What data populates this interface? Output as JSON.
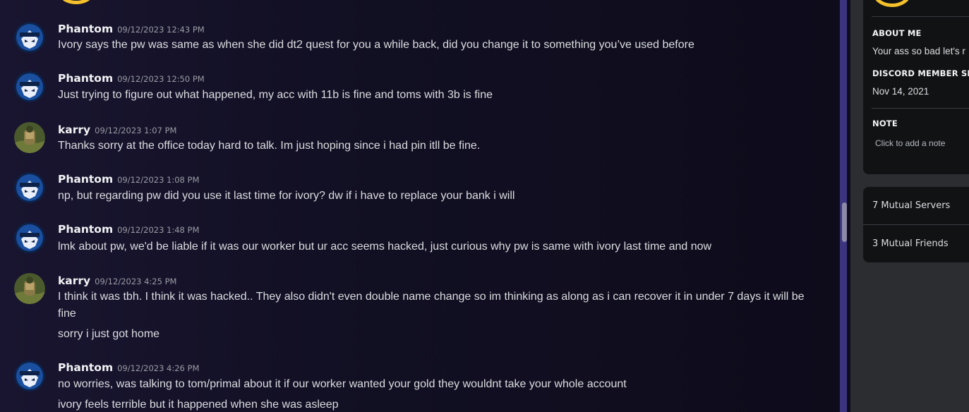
{
  "messages": [
    {
      "author": "Phantom",
      "avatar": "phantom-avatar",
      "timestamp": "09/12/2023 12:43 PM",
      "lines": [
        "Ivory says the pw was same as when she did dt2 quest for you a while back, did you change it to something you’ve used before"
      ]
    },
    {
      "author": "Phantom",
      "avatar": "phantom-avatar",
      "timestamp": "09/12/2023 12:50 PM",
      "lines": [
        "Just trying to figure out what happened, my acc with 11b is fine and toms with 3b is fine"
      ]
    },
    {
      "author": "karry",
      "avatar": "karry-avatar",
      "timestamp": "09/12/2023 1:07 PM",
      "lines": [
        "Thanks sorry at the office today hard to talk. Im just hoping since i had pin itll be fine."
      ]
    },
    {
      "author": "Phantom",
      "avatar": "phantom-avatar",
      "timestamp": "09/12/2023 1:08 PM",
      "lines": [
        "np, but regarding pw did you use it last time for ivory? dw if i have to replace your bank i will"
      ]
    },
    {
      "author": "Phantom",
      "avatar": "phantom-avatar",
      "timestamp": "09/12/2023 1:48 PM",
      "lines": [
        "lmk about pw, we'd be liable if it was our worker but ur acc seems hacked, just curious why pw is same with ivory last time and now"
      ]
    },
    {
      "author": "karry",
      "avatar": "karry-avatar",
      "timestamp": "09/12/2023 4:25 PM",
      "lines": [
        "I think it was tbh.  I think it was hacked.. They also didn't even double name change so im thinking as along as i can recover it in under 7 days it will be fine",
        "sorry i just got home"
      ]
    },
    {
      "author": "Phantom",
      "avatar": "phantom-avatar",
      "timestamp": "09/12/2023 4:26 PM",
      "lines": [
        "no worries, was talking to tom/primal about it if our worker wanted your gold they wouldnt take your whole account",
        "ivory feels terrible but it happened when she was asleep"
      ]
    }
  ],
  "profile": {
    "about_me_title": "ABOUT ME",
    "about_me_text": "Your ass so bad let's r",
    "member_since_title": "DISCORD MEMBER SIN",
    "member_since_date": "Nov 14, 2021",
    "note_title": "NOTE",
    "note_placeholder": "Click to add a note",
    "mutual_servers": "7 Mutual Servers",
    "mutual_friends": "3 Mutual Friends"
  },
  "colors": {
    "accent_avatar_ring": "#f5c12b",
    "scrollbar_track": "#3b357f",
    "panel_bg": "#2b2d31",
    "card_bg": "#111214"
  }
}
